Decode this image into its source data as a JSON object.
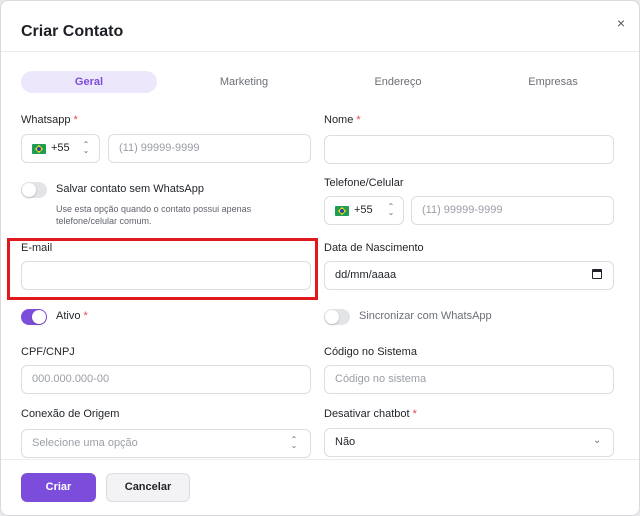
{
  "dialog": {
    "title": "Criar Contato",
    "close_symbol": "×"
  },
  "tabs": [
    {
      "label": "Geral",
      "active": true
    },
    {
      "label": "Marketing"
    },
    {
      "label": "Endereço"
    },
    {
      "label": "Empresas"
    }
  ],
  "whatsapp": {
    "label": "Whatsapp",
    "required": "*",
    "country_code": "+55",
    "placeholder": "(11) 99999-9999"
  },
  "nome": {
    "label": "Nome",
    "required": "*",
    "value": ""
  },
  "save_without_whatsapp": {
    "label": "Salvar contato sem WhatsApp",
    "enabled": false,
    "hint": "Use esta opção quando o contato possui apenas telefone/celular comum."
  },
  "telefone": {
    "label": "Telefone/Celular",
    "country_code": "+55",
    "placeholder": "(11) 99999-9999"
  },
  "email": {
    "label": "E-mail",
    "value": ""
  },
  "data_nascimento": {
    "label": "Data de Nascimento",
    "value": "dd/mm/aaaa"
  },
  "ativo": {
    "label": "Ativo",
    "required": "*",
    "enabled": true
  },
  "sincronizar": {
    "label": "Sincronizar com WhatsApp",
    "enabled": false
  },
  "cpf": {
    "label": "CPF/CNPJ",
    "placeholder": "000.000.000-00"
  },
  "codigo": {
    "label": "Código no Sistema",
    "placeholder": "Código no sistema"
  },
  "conexao": {
    "label": "Conexão de Origem",
    "placeholder": "Selecione uma opção"
  },
  "chatbot": {
    "label": "Desativar chatbot",
    "required": "*",
    "value": "Não"
  },
  "buttons": {
    "create": "Criar",
    "cancel": "Cancelar"
  },
  "colors": {
    "accent": "#7c4ddb",
    "required": "#e5484d",
    "highlight": "#e0191f"
  }
}
